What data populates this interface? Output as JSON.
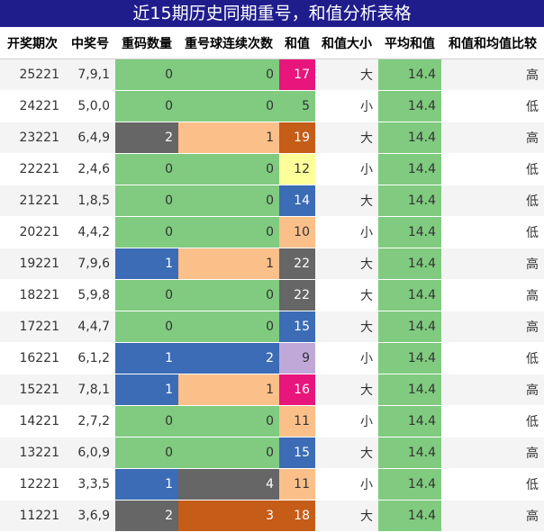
{
  "title": "近15期历史同期重号，和值分析表格",
  "headers": [
    "开奖期次",
    "中奖号",
    "重码数量",
    "重号球连续次数",
    "和值",
    "和值大小",
    "平均和值",
    "和值和均值比较"
  ],
  "colors": {
    "green": "#80cb7f",
    "gray": "#666666",
    "blue": "#3b6cb5",
    "peach": "#fbbf8a",
    "orange": "#c55c17",
    "magenta": "#e8157c",
    "light_yellow": "#ffff99",
    "lavender": "#c0a9d9",
    "header_blue": "#1f1d8c"
  },
  "rows": [
    {
      "period": "25221",
      "numbers": "7,9,1",
      "repeat": "0",
      "repeat_color": "green",
      "consec": "0",
      "consec_color": "green",
      "sum": "17",
      "sum_color": "magenta",
      "size": "大",
      "avg": "14.4",
      "compare": "高"
    },
    {
      "period": "24221",
      "numbers": "5,0,0",
      "repeat": "0",
      "repeat_color": "green",
      "consec": "0",
      "consec_color": "green",
      "sum": "5",
      "sum_color": "green",
      "size": "小",
      "avg": "14.4",
      "compare": "低"
    },
    {
      "period": "23221",
      "numbers": "6,4,9",
      "repeat": "2",
      "repeat_color": "gray",
      "consec": "1",
      "consec_color": "peach",
      "sum": "19",
      "sum_color": "orange",
      "size": "大",
      "avg": "14.4",
      "compare": "高"
    },
    {
      "period": "22221",
      "numbers": "2,4,6",
      "repeat": "0",
      "repeat_color": "green",
      "consec": "0",
      "consec_color": "green",
      "sum": "12",
      "sum_color": "light_yellow",
      "size": "小",
      "avg": "14.4",
      "compare": "低"
    },
    {
      "period": "21221",
      "numbers": "1,8,5",
      "repeat": "0",
      "repeat_color": "green",
      "consec": "0",
      "consec_color": "green",
      "sum": "14",
      "sum_color": "blue",
      "size": "大",
      "avg": "14.4",
      "compare": "低"
    },
    {
      "period": "20221",
      "numbers": "4,4,2",
      "repeat": "0",
      "repeat_color": "green",
      "consec": "0",
      "consec_color": "green",
      "sum": "10",
      "sum_color": "peach",
      "size": "小",
      "avg": "14.4",
      "compare": "低"
    },
    {
      "period": "19221",
      "numbers": "7,9,6",
      "repeat": "1",
      "repeat_color": "blue",
      "consec": "1",
      "consec_color": "peach",
      "sum": "22",
      "sum_color": "gray",
      "size": "大",
      "avg": "14.4",
      "compare": "高"
    },
    {
      "period": "18221",
      "numbers": "5,9,8",
      "repeat": "0",
      "repeat_color": "green",
      "consec": "0",
      "consec_color": "green",
      "sum": "22",
      "sum_color": "gray",
      "size": "大",
      "avg": "14.4",
      "compare": "高"
    },
    {
      "period": "17221",
      "numbers": "4,4,7",
      "repeat": "0",
      "repeat_color": "green",
      "consec": "0",
      "consec_color": "green",
      "sum": "15",
      "sum_color": "blue",
      "size": "大",
      "avg": "14.4",
      "compare": "高"
    },
    {
      "period": "16221",
      "numbers": "6,1,2",
      "repeat": "1",
      "repeat_color": "blue",
      "consec": "2",
      "consec_color": "blue",
      "sum": "9",
      "sum_color": "lavender",
      "size": "小",
      "avg": "14.4",
      "compare": "低"
    },
    {
      "period": "15221",
      "numbers": "7,8,1",
      "repeat": "1",
      "repeat_color": "blue",
      "consec": "1",
      "consec_color": "peach",
      "sum": "16",
      "sum_color": "magenta",
      "size": "大",
      "avg": "14.4",
      "compare": "高"
    },
    {
      "period": "14221",
      "numbers": "2,7,2",
      "repeat": "0",
      "repeat_color": "green",
      "consec": "0",
      "consec_color": "green",
      "sum": "11",
      "sum_color": "peach",
      "size": "小",
      "avg": "14.4",
      "compare": "低"
    },
    {
      "period": "13221",
      "numbers": "6,0,9",
      "repeat": "0",
      "repeat_color": "green",
      "consec": "0",
      "consec_color": "green",
      "sum": "15",
      "sum_color": "blue",
      "size": "大",
      "avg": "14.4",
      "compare": "高"
    },
    {
      "period": "12221",
      "numbers": "3,3,5",
      "repeat": "1",
      "repeat_color": "blue",
      "consec": "4",
      "consec_color": "gray",
      "sum": "11",
      "sum_color": "peach",
      "size": "小",
      "avg": "14.4",
      "compare": "低"
    },
    {
      "period": "11221",
      "numbers": "3,6,9",
      "repeat": "2",
      "repeat_color": "gray",
      "consec": "3",
      "consec_color": "orange",
      "sum": "18",
      "sum_color": "orange",
      "size": "大",
      "avg": "14.4",
      "compare": "高"
    }
  ]
}
